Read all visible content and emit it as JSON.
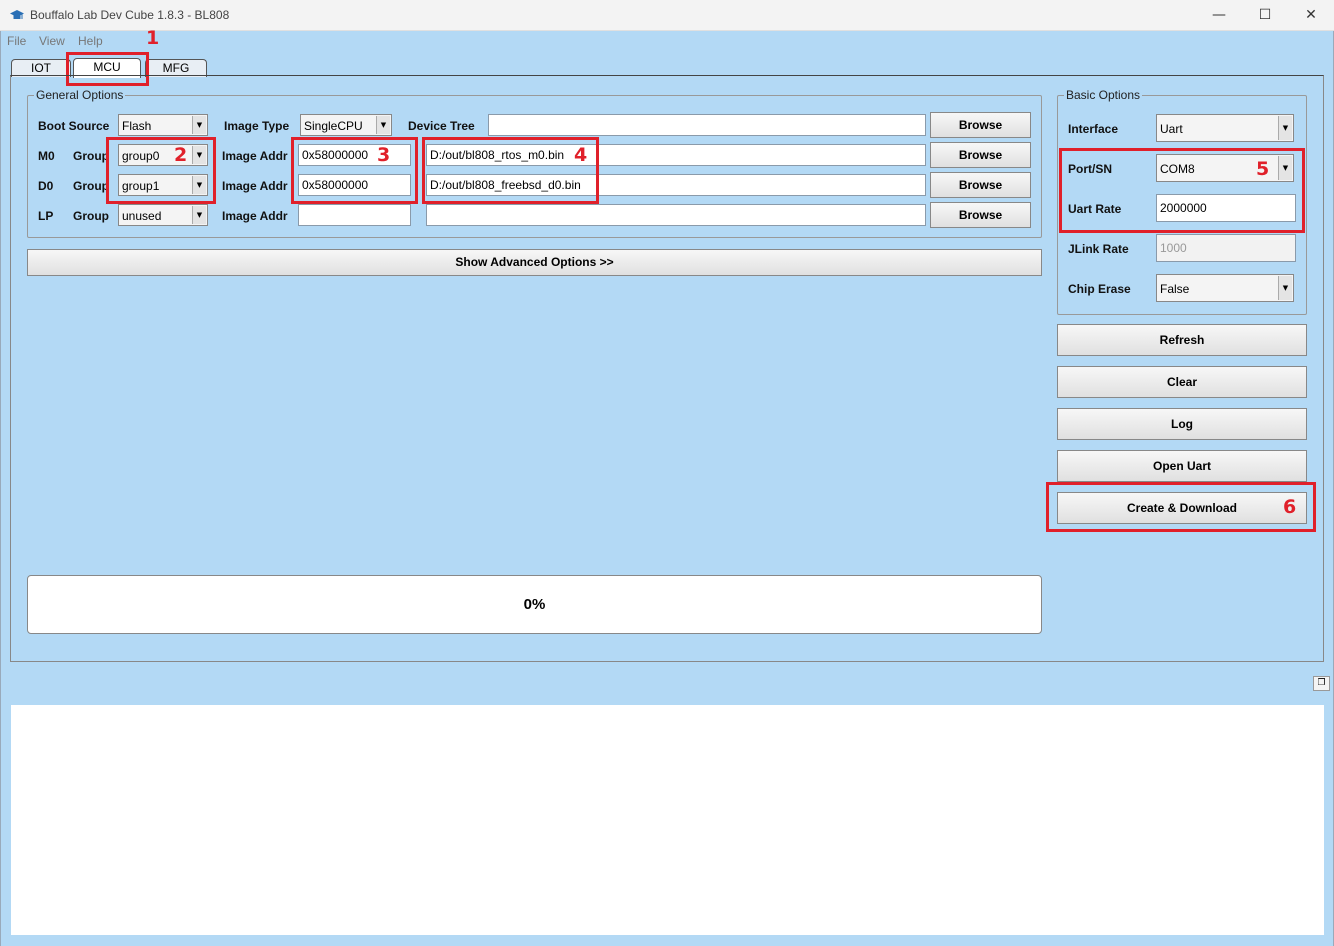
{
  "titlebar": {
    "title": "Bouffalo Lab Dev Cube 1.8.3 - BL808",
    "minimize": "—",
    "maximize": "☐",
    "close": "✕"
  },
  "menu": [
    "File",
    "View",
    "Help"
  ],
  "tabs": [
    {
      "label": "IOT",
      "active": false
    },
    {
      "label": "MCU",
      "active": true
    },
    {
      "label": "MFG",
      "active": false
    }
  ],
  "general": {
    "title": "General Options",
    "boot_source_label": "Boot Source",
    "boot_source_value": "Flash",
    "image_type_label": "Image Type",
    "image_type_value": "SingleCPU",
    "device_tree_label": "Device Tree",
    "device_tree_value": "",
    "rows": [
      {
        "core": "M0",
        "group_label": "Group",
        "group_value": "group0",
        "addr_label": "Image Addr",
        "addr_value": "0x58000000",
        "path": "D:/out/bl808_rtos_m0.bin"
      },
      {
        "core": "D0",
        "group_label": "Group",
        "group_value": "group1",
        "addr_label": "Image Addr",
        "addr_value": "0x58000000",
        "path": "D:/out/bl808_freebsd_d0.bin"
      },
      {
        "core": "LP",
        "group_label": "Group",
        "group_value": "unused",
        "addr_label": "Image Addr",
        "addr_value": "",
        "path": ""
      }
    ],
    "browse_label": "Browse",
    "advanced_button": "Show Advanced Options >>"
  },
  "basic": {
    "title": "Basic Options",
    "interface_label": "Interface",
    "interface_value": "Uart",
    "port_label": "Port/SN",
    "port_value": "COM8",
    "uart_rate_label": "Uart Rate",
    "uart_rate_value": "2000000",
    "jlink_rate_label": "JLink Rate",
    "jlink_rate_value": "1000",
    "chip_erase_label": "Chip Erase",
    "chip_erase_value": "False"
  },
  "actions": {
    "refresh": "Refresh",
    "clear": "Clear",
    "log": "Log",
    "open_uart": "Open Uart",
    "create_download": "Create & Download"
  },
  "progress": {
    "text": "0%",
    "value": 0
  },
  "annotations": [
    "1",
    "2",
    "3",
    "4",
    "5",
    "6"
  ],
  "colors": {
    "annotation": "#e0202a",
    "window_bg": "#b3d9f5"
  }
}
